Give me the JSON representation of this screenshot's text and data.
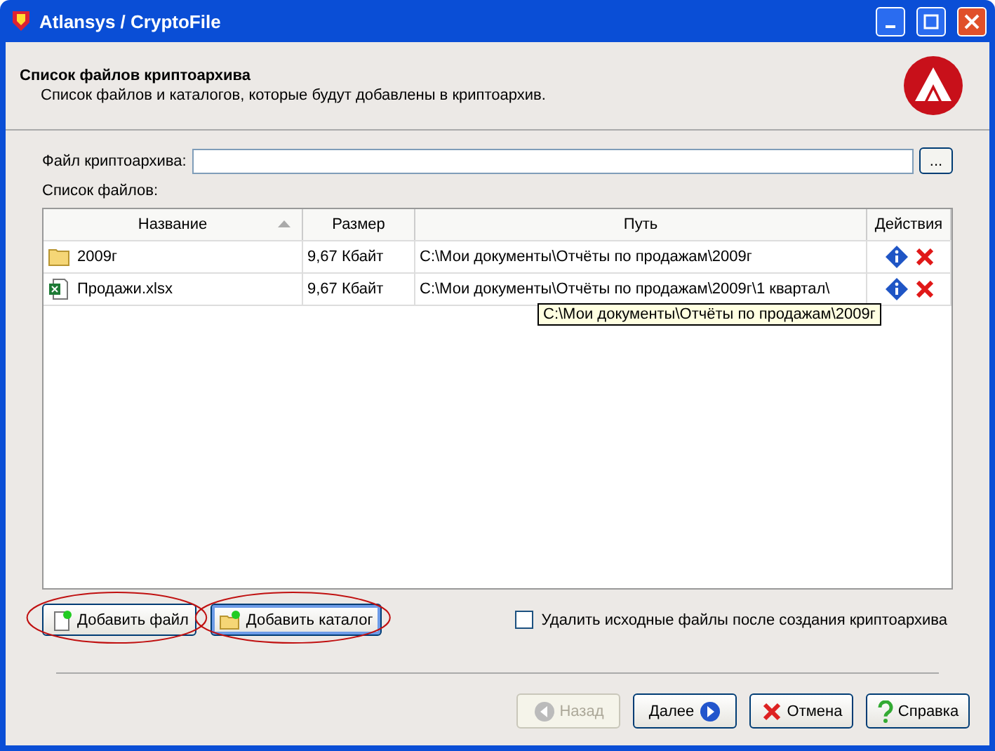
{
  "window": {
    "title": "Atlansys / CryptoFile"
  },
  "header": {
    "title": "Список файлов криптоархива",
    "subtitle": "Список файлов и каталогов, которые будут добавлены в криптоархив."
  },
  "archive_field": {
    "label": "Файл криптоархива:",
    "browse": "..."
  },
  "files_label": "Список файлов:",
  "table": {
    "columns": [
      {
        "label": "Название",
        "sorted": true
      },
      {
        "label": "Размер",
        "sorted": false
      },
      {
        "label": "Путь",
        "sorted": false
      },
      {
        "label": "Действия",
        "sorted": false
      }
    ],
    "rows": [
      {
        "kind": "folder",
        "name": "2009г",
        "size": "9,67 Кбайт",
        "path": "C:\\Мои документы\\Отчёты по продажам\\2009г"
      },
      {
        "kind": "excel",
        "name": "Продажи.xlsx",
        "size": "9,67 Кбайт",
        "path": "C:\\Мои документы\\Отчёты по продажам\\2009г\\1 квартал\\"
      }
    ],
    "tooltip": "C:\\Мои документы\\Отчёты по продажам\\2009г"
  },
  "add_buttons": [
    {
      "kind": "file",
      "label": "Добавить файл",
      "circled": true,
      "focused": false
    },
    {
      "kind": "folder",
      "label": "Добавить каталог",
      "circled": true,
      "focused": true
    }
  ],
  "delete_sources": {
    "label": "Удалить исходные файлы после создания криптоархива",
    "checked": false
  },
  "nav_buttons": [
    {
      "kind": "back",
      "label": "Назад",
      "disabled": true
    },
    {
      "kind": "next",
      "label": "Далее",
      "disabled": false
    },
    {
      "kind": "cancel",
      "label": "Отмена",
      "disabled": false
    },
    {
      "kind": "help",
      "label": "Справка",
      "disabled": false
    }
  ]
}
